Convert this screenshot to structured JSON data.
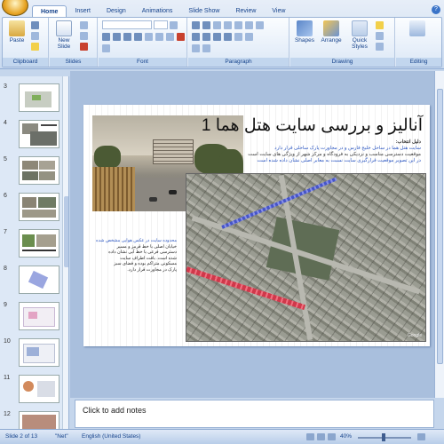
{
  "ribbon": {
    "tabs": [
      "Home",
      "Insert",
      "Design",
      "Animations",
      "Slide Show",
      "Review",
      "View"
    ],
    "active_tab": "Home",
    "groups": {
      "clipboard": {
        "label": "Clipboard",
        "paste_label": "Paste"
      },
      "slides": {
        "label": "Slides",
        "new_slide_label": "New Slide"
      },
      "font": {
        "label": "Font"
      },
      "paragraph": {
        "label": "Paragraph"
      },
      "drawing": {
        "label": "Drawing",
        "shapes_label": "Shapes",
        "arrange_label": "Arrange",
        "quick_styles_label": "Quick Styles"
      },
      "editing": {
        "label": "Editing"
      }
    }
  },
  "slide_panel": {
    "thumbnails": [
      {
        "number": "3"
      },
      {
        "number": "4"
      },
      {
        "number": "5"
      },
      {
        "number": "6"
      },
      {
        "number": "7"
      },
      {
        "number": "8"
      },
      {
        "number": "9"
      },
      {
        "number": "10"
      },
      {
        "number": "11"
      },
      {
        "number": "12"
      }
    ]
  },
  "slide": {
    "title": "آنالیز و بررسی سایت  هتل هما 1",
    "body_heading": "دلیل انتخاب:",
    "body_lines": [
      "سایت هتل هما در ساحل خلیج فارس و در مجاورت پارک ساحلی قرار دارد",
      "موقعیت دسترسی مناسب و نزدیکی به فرودگاه و مرکز شهر از ویژگی های سایت است",
      "در این تصویر موقعیت قرارگیری سایت نسبت به معابر اصلی نشان داده شده است"
    ],
    "left_lines": [
      "محدوده سایت در عکس هوایی مشخص شده",
      "خیابان اصلی با خط قرمز و مسیر",
      "دسترسی فرعی با خط آبی نشان داده",
      "شده است. بافت اطراف سایت",
      "مسکونی متراکم بوده و فضای سبز",
      "پارک در مجاورت قرار دارد."
    ],
    "aerial_logo": "Google"
  },
  "notes": {
    "placeholder": "Click to add notes"
  },
  "status_bar": {
    "slide_indicator": "Slide 2 of 13",
    "theme": "\"Net\"",
    "language": "English (United States)",
    "zoom": "40%"
  },
  "colors": {
    "ribbon_text": "#15428b",
    "accent": "#e8a020",
    "red_path": "#d0384a",
    "blue_path": "#4655c8"
  }
}
